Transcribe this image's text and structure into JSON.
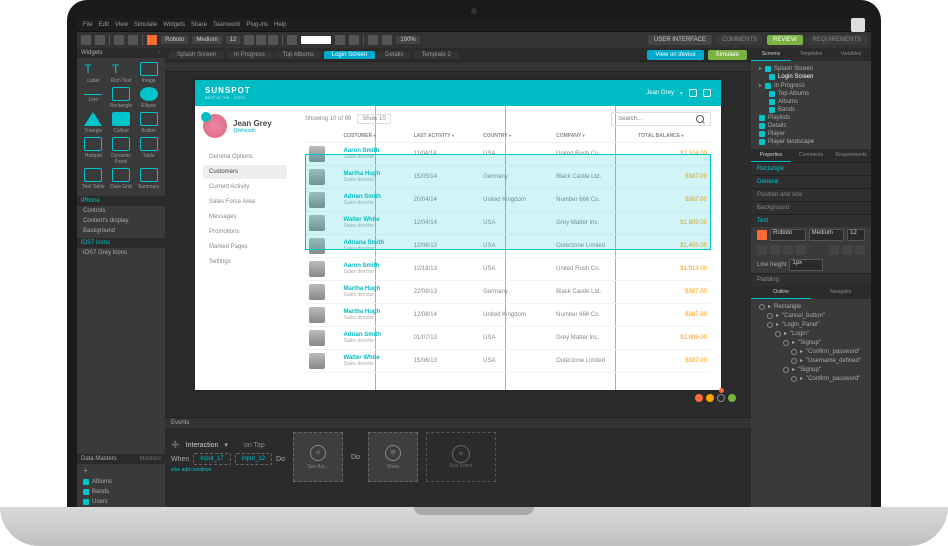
{
  "menubar": [
    "File",
    "Edit",
    "View",
    "Simulate",
    "Widgets",
    "Share",
    "Teamwork",
    "Plug-ins",
    "Help"
  ],
  "toolbar": {
    "font": "Roboto",
    "weight": "Medium",
    "size": "12",
    "zoom": "100%",
    "right": {
      "user": "USER INTERFACE",
      "comments": "COMMENTS",
      "review": "REVIEW",
      "req": "REQUIREMENTS"
    },
    "view_device": "View on device",
    "simulate": "Simulate"
  },
  "tabs": {
    "items": [
      "Splash Screen",
      "In Progress",
      "Top Albums",
      "Login Screen",
      "Details",
      "Template 2"
    ],
    "active": 3
  },
  "widgets_panel": {
    "title": "Widgets",
    "items": [
      "Label",
      "Rich Text",
      "Image",
      "Line",
      "Rectangle",
      "Ellipse",
      "Triangle",
      "Callout",
      "Button",
      "Hotspot",
      "Dynamic Panel",
      "Table",
      "Text Table",
      "Data Grid",
      "Summary"
    ]
  },
  "sections": {
    "iphone": "iPhone",
    "controls": "Controls",
    "contents": "Content's display",
    "background": "Background",
    "ios": "iOS7 icons",
    "ios_gray": "iOS7 Grey Icons"
  },
  "datamasters": {
    "tabs": [
      "Data Masters",
      "Masters"
    ],
    "add": "+",
    "items": [
      "Albums",
      "Bands",
      "Users"
    ]
  },
  "prototype": {
    "brand": "SUNSPOT",
    "tagline": "BEST IN THE... EVER",
    "user": {
      "name": "Jean Grey",
      "handle": "@telepath"
    },
    "topbar_user": "Jean Grey",
    "nav": [
      "General Options",
      "Customers",
      "Current Activity",
      "Sales Force Area",
      "Messages",
      "Promotions",
      "Marked Pages",
      "Settings"
    ],
    "nav_active": 1,
    "showing": "Showing 10 of 99",
    "show": "Show 10",
    "search_placeholder": "Search...",
    "columns": [
      "COSTUMER",
      "LAST ACTIVITY",
      "COUNTRY",
      "COMPANY",
      "TOTAL BALANCE"
    ],
    "rows": [
      {
        "name": "Aaron Smith",
        "role": "Sales director",
        "date": "11/04/14",
        "country": "USA",
        "company": "United Rush Co.",
        "balance": "$1,324.00"
      },
      {
        "name": "Martha Hugh",
        "role": "Sales director",
        "date": "15/05/14",
        "country": "Germany",
        "company": "Black Castle Ltd.",
        "balance": "$387.00"
      },
      {
        "name": "Adrian Smith",
        "role": "Sales director",
        "date": "20/04/14",
        "country": "United Kingdom",
        "company": "Number 666 Co.",
        "balance": "$387.00"
      },
      {
        "name": "Walter White",
        "role": "Sales director",
        "date": "12/04/14",
        "country": "USA",
        "company": "Grey Matter Inc.",
        "balance": "$1,809.00"
      },
      {
        "name": "Adriana Smith",
        "role": "Sales director",
        "date": "12/06/13",
        "country": "USA",
        "company": "Outerzone Limited",
        "balance": "$1,455.00"
      },
      {
        "name": "Aaron Smith",
        "role": "Sales director",
        "date": "12/18/13",
        "country": "USA",
        "company": "United Rush Co.",
        "balance": "$1,913.00"
      },
      {
        "name": "Martha Hugh",
        "role": "Sales director",
        "date": "22/08/13",
        "country": "Germany",
        "company": "Black Castle Ltd.",
        "balance": "$387.00"
      },
      {
        "name": "Martha Hugh",
        "role": "Sales director",
        "date": "12/08/14",
        "country": "United Kingdom",
        "company": "Number 666 Co.",
        "balance": "$387.00"
      },
      {
        "name": "Adrian Smith",
        "role": "Sales director",
        "date": "01/07/13",
        "country": "USA",
        "company": "Grey Matter Inc.",
        "balance": "$1,809.00"
      },
      {
        "name": "Walter White",
        "role": "Sales director",
        "date": "15/06/13",
        "country": "USA",
        "company": "Outerzone Limited",
        "balance": "$387.00"
      }
    ]
  },
  "events": {
    "title": "Events",
    "interaction": "Interaction",
    "on_tap": "on Tap",
    "when": "When",
    "inputs": [
      "Input_17",
      "Input_12"
    ],
    "do": "Do",
    "else": "else add condition",
    "see_act": "See Act...",
    "show": "Show",
    "add": "Add Event"
  },
  "right": {
    "screens_tabs": [
      "Screens",
      "Templates",
      "Variables"
    ],
    "tree": [
      {
        "label": "Splash Screen",
        "lvl": 0,
        "folder": true
      },
      {
        "label": "Login Screen",
        "lvl": 1,
        "sel": true
      },
      {
        "label": "In Progress",
        "lvl": 0,
        "folder": true
      },
      {
        "label": "Top Albums",
        "lvl": 1
      },
      {
        "label": "Albums",
        "lvl": 1
      },
      {
        "label": "Bands",
        "lvl": 1
      },
      {
        "label": "Playlists",
        "lvl": 0
      },
      {
        "label": "Details",
        "lvl": 0
      },
      {
        "label": "Player",
        "lvl": 0
      },
      {
        "label": "Player landscape",
        "lvl": 0
      }
    ],
    "prop_tabs": [
      "Properties",
      "Comments",
      "Requirements"
    ],
    "shape": "Rectangle",
    "sections": [
      "General",
      "Position and size",
      "Background",
      "Text"
    ],
    "font": "Roboto",
    "weight": "Medium",
    "size": "12",
    "line_height": "Line height",
    "lh_val": "1px",
    "padding": "Padding",
    "outline_tabs": [
      "Outline",
      "Navigator"
    ],
    "outline": [
      {
        "label": "Rectangle",
        "lvl": 0
      },
      {
        "label": "\"Cancel_button\"",
        "lvl": 1
      },
      {
        "label": "\"Login_Panel\"",
        "lvl": 1
      },
      {
        "label": "\"Login\"",
        "lvl": 2
      },
      {
        "label": "\"Signup\"",
        "lvl": 3
      },
      {
        "label": "\"Confirm_password\"",
        "lvl": 4
      },
      {
        "label": "\"Username_defined\"",
        "lvl": 4
      },
      {
        "label": "\"Signup\"",
        "lvl": 3
      },
      {
        "label": "\"Confirm_password\"",
        "lvl": 4
      }
    ]
  }
}
